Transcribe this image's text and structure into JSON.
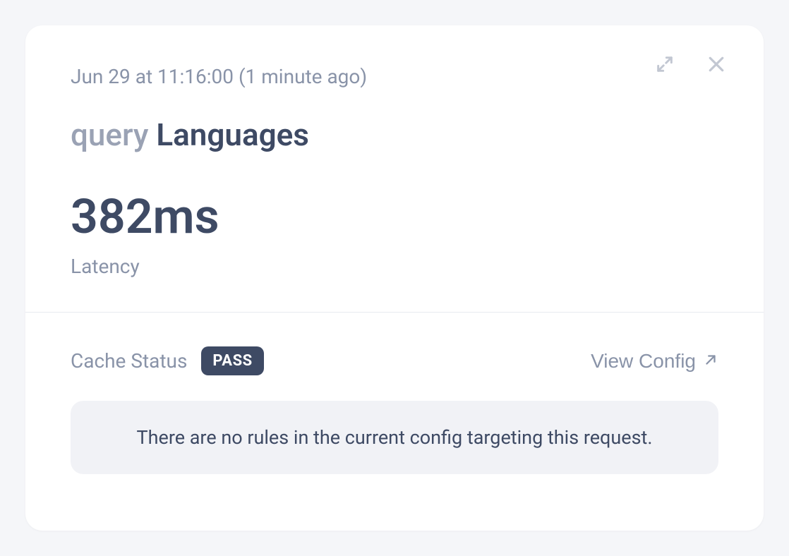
{
  "header": {
    "timestamp": "Jun 29 at 11:16:00 (1 minute ago)",
    "type_label": "query",
    "name": "Languages",
    "latency_value": "382ms",
    "latency_label": "Latency"
  },
  "cache": {
    "label": "Cache Status",
    "badge": "PASS",
    "view_config_label": "View Config",
    "message": "There are no rules in the current config targeting this request."
  }
}
